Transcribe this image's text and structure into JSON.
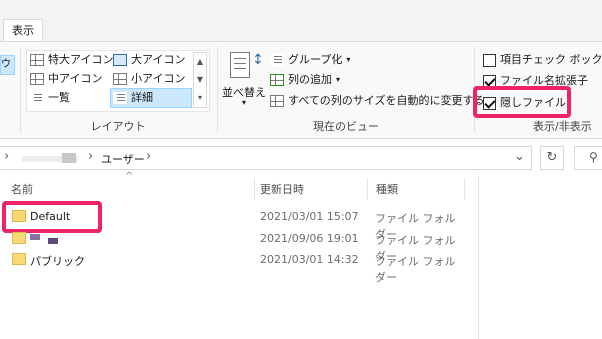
{
  "ribbon": {
    "tab_label": "表示",
    "left_cut_label": "ウ",
    "layout": {
      "items": [
        {
          "label": "特大アイコン",
          "icon": "xl-icons-icon"
        },
        {
          "label": "大アイコン",
          "icon": "large-icons-icon"
        },
        {
          "label": "中アイコン",
          "icon": "medium-icons-icon"
        },
        {
          "label": "小アイコン",
          "icon": "small-icons-icon"
        },
        {
          "label": "一覧",
          "icon": "list-icon"
        },
        {
          "label": "詳細",
          "icon": "details-icon",
          "selected": true
        }
      ],
      "group_label": "レイアウト"
    },
    "current_view": {
      "sort_label": "並べ替え",
      "group_by_label": "グループ化",
      "add_column_label": "列の追加",
      "fit_columns_label": "すべての列のサイズを自動的に変更する",
      "group_label": "現在のビュー"
    },
    "show_hide": {
      "item_checkboxes": {
        "label": "項目チェック ボックス",
        "checked": false
      },
      "file_extensions": {
        "label": "ファイル名拡張子",
        "checked": true
      },
      "hidden_items": {
        "label": "隠しファイル",
        "checked": true
      },
      "group_label": "表示/非表示"
    }
  },
  "address": {
    "breadcrumb_sep": "›",
    "path_current": "ユーザー",
    "refresh_glyph": "↻",
    "dropdown_glyph": "⌄",
    "search_glyph": "⚲"
  },
  "file_list": {
    "sort_indicator": "^",
    "columns": {
      "name": "名前",
      "modified": "更新日時",
      "type": "種類"
    },
    "rows": [
      {
        "name": "Default",
        "modified": "2021/03/01 15:07",
        "type": "ファイル フォルダー",
        "highlighted": true
      },
      {
        "name": "",
        "modified": "2021/09/06 19:01",
        "type": "ファイル フォルダー",
        "redacted": true
      },
      {
        "name": "パブリック",
        "modified": "2021/03/01 14:32",
        "type": "ファイル フォルダー"
      }
    ]
  },
  "colors": {
    "highlight": "#ee2466",
    "selected_bg": "#cce8ff",
    "folder": "#f7d978"
  }
}
